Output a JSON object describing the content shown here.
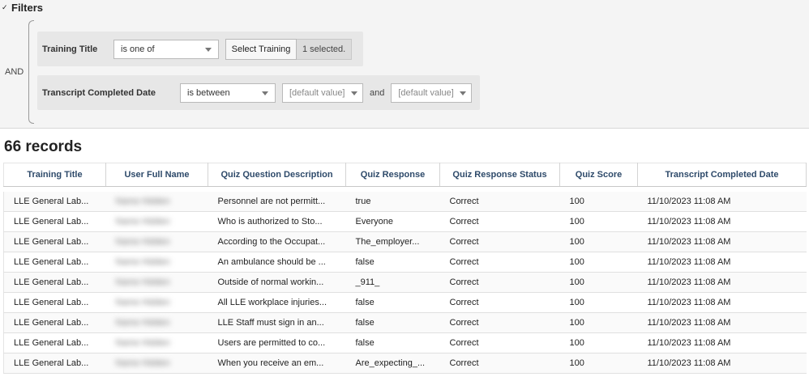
{
  "filters": {
    "header": "Filters",
    "logic": "AND",
    "rows": [
      {
        "label": "Training Title",
        "operator": "is one of",
        "button_label": "Select Training",
        "selected_text": "1 selected."
      },
      {
        "label": "Transcript Completed Date",
        "operator": "is between",
        "from_placeholder": "[default value]",
        "joiner": "and",
        "to_placeholder": "[default value]"
      }
    ]
  },
  "records": {
    "count_label": "66 records",
    "columns": [
      "Training Title",
      "User Full Name",
      "Quiz Question Description",
      "Quiz Response",
      "Quiz Response Status",
      "Quiz Score",
      "Transcript Completed Date"
    ],
    "rows": [
      [
        "LLE General Lab...",
        "Name Hidden",
        "Personnel are not permitt...",
        "true",
        "Correct",
        "100",
        "11/10/2023 11:08 AM"
      ],
      [
        "LLE General Lab...",
        "Name Hidden",
        "Who is authorized to Sto...",
        "Everyone",
        "Correct",
        "100",
        "11/10/2023 11:08 AM"
      ],
      [
        "LLE General Lab...",
        "Name Hidden",
        "According to the Occupat...",
        "The_employer...",
        "Correct",
        "100",
        "11/10/2023 11:08 AM"
      ],
      [
        "LLE General Lab...",
        "Name Hidden",
        "An ambulance should be ...",
        "false",
        "Correct",
        "100",
        "11/10/2023 11:08 AM"
      ],
      [
        "LLE General Lab...",
        "Name Hidden",
        "Outside of normal workin...",
        "_911_",
        "Correct",
        "100",
        "11/10/2023 11:08 AM"
      ],
      [
        "LLE General Lab...",
        "Name Hidden",
        "All LLE workplace injuries...",
        "false",
        "Correct",
        "100",
        "11/10/2023 11:08 AM"
      ],
      [
        "LLE General Lab...",
        "Name Hidden",
        "LLE Staff must sign in an...",
        "false",
        "Correct",
        "100",
        "11/10/2023 11:08 AM"
      ],
      [
        "LLE General Lab...",
        "Name Hidden",
        "Users are permitted to co...",
        "false",
        "Correct",
        "100",
        "11/10/2023 11:08 AM"
      ],
      [
        "LLE General Lab...",
        "Name Hidden",
        "When you receive an em...",
        "Are_expecting_...",
        "Correct",
        "100",
        "11/10/2023 11:08 AM"
      ]
    ]
  }
}
